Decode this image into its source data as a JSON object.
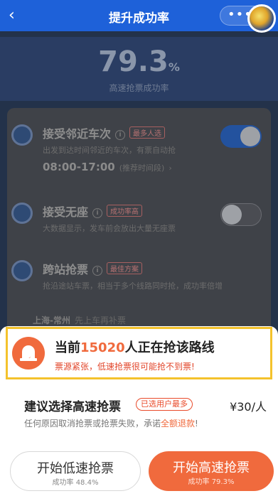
{
  "header": {
    "back_icon": "chevron-left-icon",
    "title": "提升成功率",
    "more_icon": "more-dots-icon"
  },
  "rate": {
    "value": "79.3",
    "unit": "%",
    "label": "高速抢票成功率"
  },
  "options": [
    {
      "title": "接受邻近车次",
      "tag": "最多人选",
      "desc": "出发到达时间邻近的车次，有票自动抢",
      "time": "08:00-17:00",
      "time_hint": "(推荐时间段)",
      "enabled": true
    },
    {
      "title": "接受无座",
      "tag": "成功率高",
      "desc": "大数据显示，发车前会放出大量无座票",
      "enabled": false
    },
    {
      "title": "跨站抢票",
      "tag": "最佳方案",
      "desc": "抢沿途站车票，相当于多个线路同时抢，成功率倍增"
    }
  ],
  "route": {
    "name": "上海-常州",
    "note": "先上车再补票"
  },
  "alert": {
    "prefix": "当前",
    "count": "15020",
    "suffix": "人正在抢该路线",
    "sub": "票源紧张，低速抢票很可能抢不到票!"
  },
  "suggest": {
    "title": "建议选择高速抢票",
    "tag": "已选用户最多",
    "price": "¥30/人",
    "desc_prefix": "任何原因取消抢票或抢票失败，承诺",
    "desc_highlight": "全额退款",
    "desc_suffix": "!"
  },
  "buttons": {
    "low_label": "开始低速抢票",
    "low_rate": "成功率 48.4%",
    "high_label": "开始高速抢票",
    "high_rate": "成功率 79.3%"
  },
  "colors": {
    "brand_blue": "#1e61d9",
    "accent_orange": "#f06a3d",
    "highlight_border": "#f4c22c"
  }
}
